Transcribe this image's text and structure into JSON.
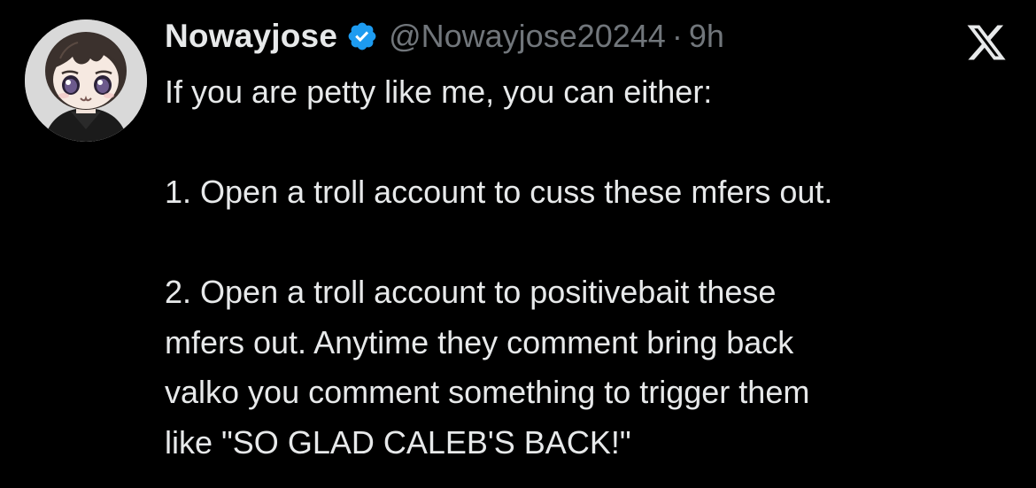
{
  "tweet": {
    "author": {
      "display_name": "Nowayjose",
      "handle": "@Nowayjose20244",
      "verified": true,
      "avatar_icon": "anime-avatar-icon"
    },
    "separator": "·",
    "time": "9h",
    "platform_icon": "x-logo-icon",
    "text_lines": {
      "intro": "If you are petty like me, you can either:",
      "option1": "1. Open a troll account to cuss these mfers out.",
      "option2_line1": "2. Open a troll account to positivebait these",
      "option2_line2": "mfers out. Anytime they comment bring back",
      "option2_line3": "valko you comment something to trigger them",
      "option2_line4": "like \"SO GLAD CALEB'S BACK!\""
    },
    "colors": {
      "background": "#000000",
      "primary_text": "#e7e9ea",
      "secondary_text": "#71767b",
      "verified_badge": "#1d9bf0"
    }
  }
}
